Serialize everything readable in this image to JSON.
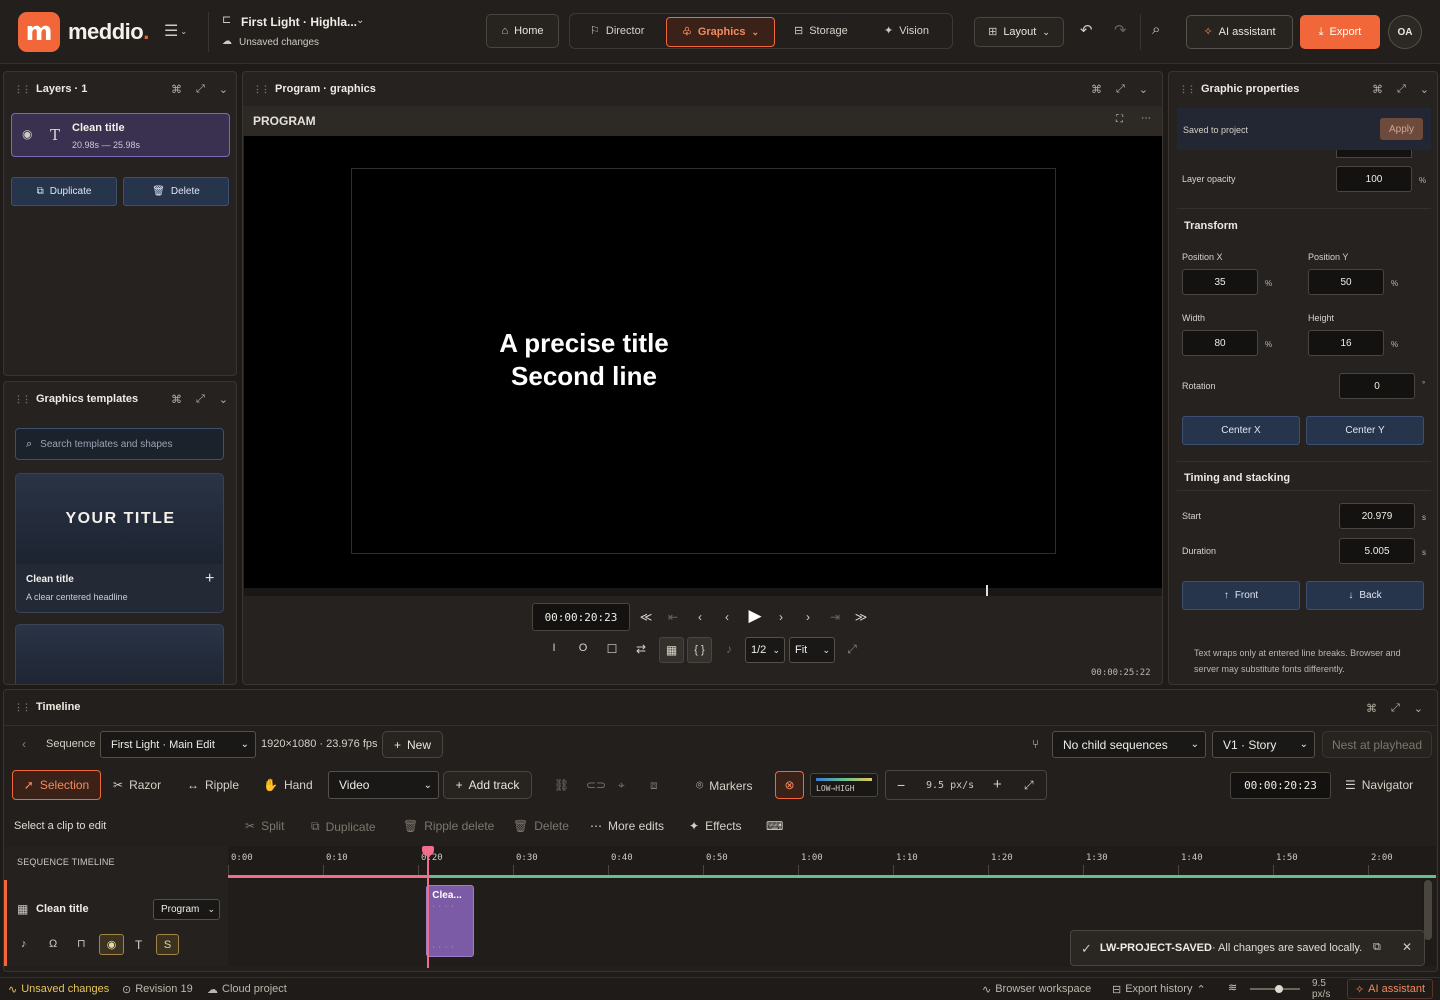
{
  "app": {
    "logo_text": "meddio",
    "project_title": "First Light · Highla...",
    "unsaved_label": "Unsaved changes"
  },
  "nav": {
    "home": "Home",
    "director": "Director",
    "graphics": "Graphics",
    "storage": "Storage",
    "vision": "Vision",
    "layout": "Layout",
    "ai_assistant": "AI assistant",
    "export": "Export",
    "avatar": "OA"
  },
  "colors": {
    "accent": "#f2673a",
    "clip": "#7b5aa6",
    "playhead": "#f06d8c",
    "green": "#67c08c"
  },
  "layers": {
    "title": "Layers · 1",
    "items": [
      {
        "name": "Clean title",
        "range": "20.98s — 25.98s"
      }
    ],
    "duplicate": "Duplicate",
    "delete": "Delete"
  },
  "templates": {
    "title": "Graphics templates",
    "search_placeholder": "Search templates and shapes",
    "items": [
      {
        "preview": "YOUR TITLE",
        "name": "Clean title",
        "desc": "A clear centered headline"
      }
    ]
  },
  "program": {
    "title": "Program · graphics",
    "label": "PROGRAM",
    "text_line1": "A precise title",
    "text_line2": "Second line",
    "timecode": "00:00:20:23",
    "end_timecode": "00:00:25:22",
    "mark_in": "I",
    "mark_out": "O",
    "resolution": "1/2",
    "zoom": "Fit"
  },
  "props": {
    "title": "Graphic properties",
    "saved": "Saved to project",
    "apply": "Apply",
    "opacity_label": "Layer opacity",
    "opacity": "100",
    "transform_label": "Transform",
    "posx_label": "Position X",
    "posx": "35",
    "posy_label": "Position Y",
    "posy": "50",
    "width_label": "Width",
    "width": "80",
    "height_label": "Height",
    "height": "16",
    "rotation_label": "Rotation",
    "rotation": "0",
    "percent": "%",
    "degree": "°",
    "seconds": "s",
    "centerx": "Center X",
    "centery": "Center Y",
    "timing_label": "Timing and stacking",
    "start_label": "Start",
    "start": "20.979",
    "duration_label": "Duration",
    "duration": "5.005",
    "front": "Front",
    "back": "Back",
    "note": "Text wraps only at entered line breaks. Browser and server may substitute fonts differently."
  },
  "timeline": {
    "title": "Timeline",
    "sequence_label": "Sequence",
    "sequence": "First Light · Main Edit",
    "format": "1920×1080 · 23.976 fps",
    "new": "New",
    "child_seq": "No child sequences",
    "track_select": "V1 · Story",
    "nest": "Nest at playhead",
    "selection": "Selection",
    "razor": "Razor",
    "ripple": "Ripple",
    "hand": "Hand",
    "track_type": "Video",
    "add_track": "Add track",
    "markers": "Markers",
    "waveform": "LOW→HIGH",
    "zoom": "9.5 px/s",
    "timecode": "00:00:20:23",
    "navigator": "Navigator",
    "hint": "Select a clip to edit",
    "split": "Split",
    "duplicate": "Duplicate",
    "ripple_delete": "Ripple delete",
    "delete": "Delete",
    "more_edits": "More edits",
    "effects": "Effects",
    "seq_label": "SEQUENCE TIMELINE",
    "ticks": [
      "0:00",
      "0:10",
      "0:20",
      "0:30",
      "0:40",
      "0:50",
      "1:00",
      "1:10",
      "1:20",
      "1:30",
      "1:40",
      "1:50",
      "2:00"
    ],
    "track_name": "Clean title",
    "track_target": "Program",
    "clip_label": "Clea...",
    "track_t": "T",
    "track_s": "S",
    "playhead_seconds": 20.98,
    "clip_start": 20.98,
    "clip_end": 25.98
  },
  "toast": {
    "code": "LW-PROJECT-SAVED",
    "message": " · All changes are saved locally."
  },
  "status": {
    "unsaved": "Unsaved changes",
    "revision": "Revision 19",
    "cloud": "Cloud project",
    "workspace": "Browser workspace",
    "export_history": "Export history",
    "zoom": "9.5 px/s",
    "ai": "AI assistant"
  }
}
